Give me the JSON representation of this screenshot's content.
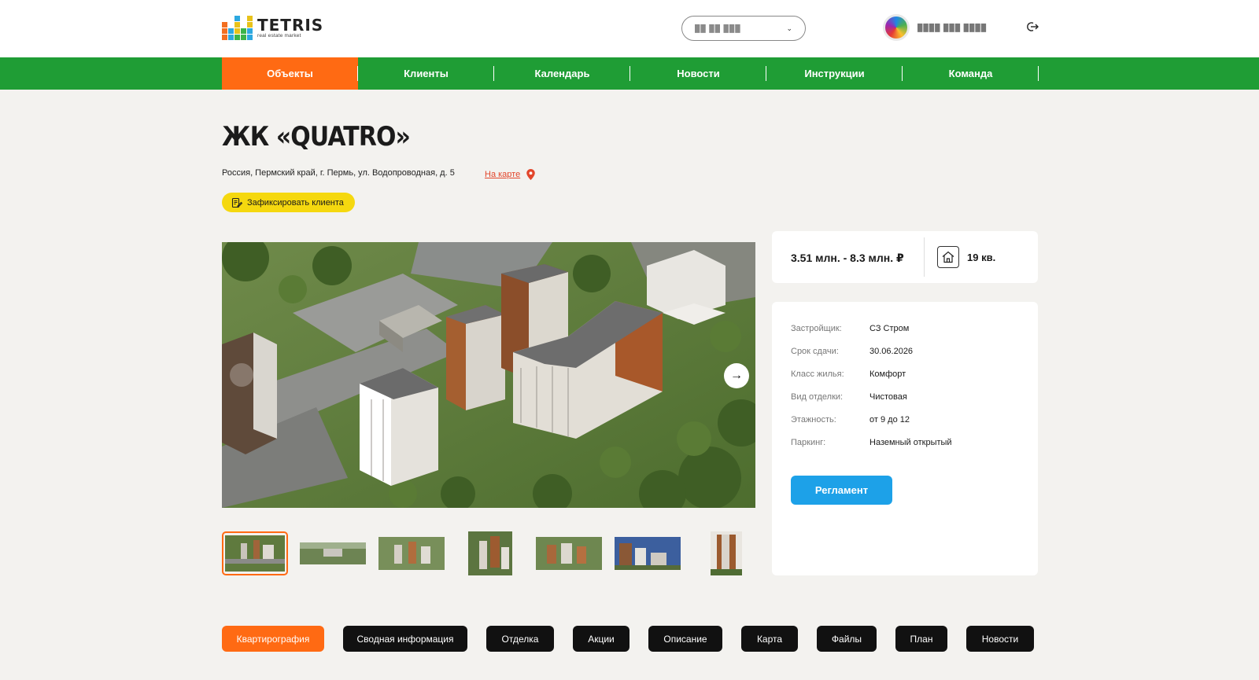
{
  "header": {
    "logo": {
      "name": "TETRIS",
      "tagline": "real estate market"
    },
    "city_select": {
      "value": "██ ██ ███",
      "chevron": "chevron-down-icon"
    },
    "user": {
      "name": "████ ███ ████"
    },
    "logout_icon": "logout-icon"
  },
  "nav": {
    "items": [
      {
        "label": "Объекты",
        "active": true
      },
      {
        "label": "Клиенты",
        "active": false
      },
      {
        "label": "Календарь",
        "active": false
      },
      {
        "label": "Новости",
        "active": false
      },
      {
        "label": "Инструкции",
        "active": false
      },
      {
        "label": "Команда",
        "active": false
      }
    ]
  },
  "object": {
    "title": "ЖК «QUATRO»",
    "address": "Россия, Пермский край, г. Пермь, ул. Водопроводная, д. 5",
    "map_link": "На карте",
    "fix_client": "Зафиксировать клиента"
  },
  "gallery": {
    "thumbnail_count": 7,
    "active_index": 0
  },
  "price_card": {
    "price_range": "3.51 млн. - 8.3 млн. ₽",
    "apartments": "19 кв."
  },
  "info": {
    "rows": [
      {
        "label": "Застройщик:",
        "value": "СЗ Стром"
      },
      {
        "label": "Срок сдачи:",
        "value": "30.06.2026"
      },
      {
        "label": "Класс жилья:",
        "value": "Комфорт"
      },
      {
        "label": "Вид отделки:",
        "value": "Чистовая"
      },
      {
        "label": "Этажность:",
        "value": "от 9 до 12"
      },
      {
        "label": "Паркинг:",
        "value": "Наземный открытый"
      }
    ],
    "button": "Регламент"
  },
  "tabs": [
    {
      "label": "Квартирография",
      "active": true
    },
    {
      "label": "Сводная информация",
      "active": false
    },
    {
      "label": "Отделка",
      "active": false
    },
    {
      "label": "Акции",
      "active": false
    },
    {
      "label": "Описание",
      "active": false
    },
    {
      "label": "Карта",
      "active": false
    },
    {
      "label": "Файлы",
      "active": false
    },
    {
      "label": "План",
      "active": false
    },
    {
      "label": "Новости",
      "active": false
    }
  ],
  "colors": {
    "nav_green": "#1f9d35",
    "accent_orange": "#ff6a13",
    "button_yellow": "#f5d80f",
    "button_blue": "#1da1e8",
    "link_red": "#e2462b"
  }
}
